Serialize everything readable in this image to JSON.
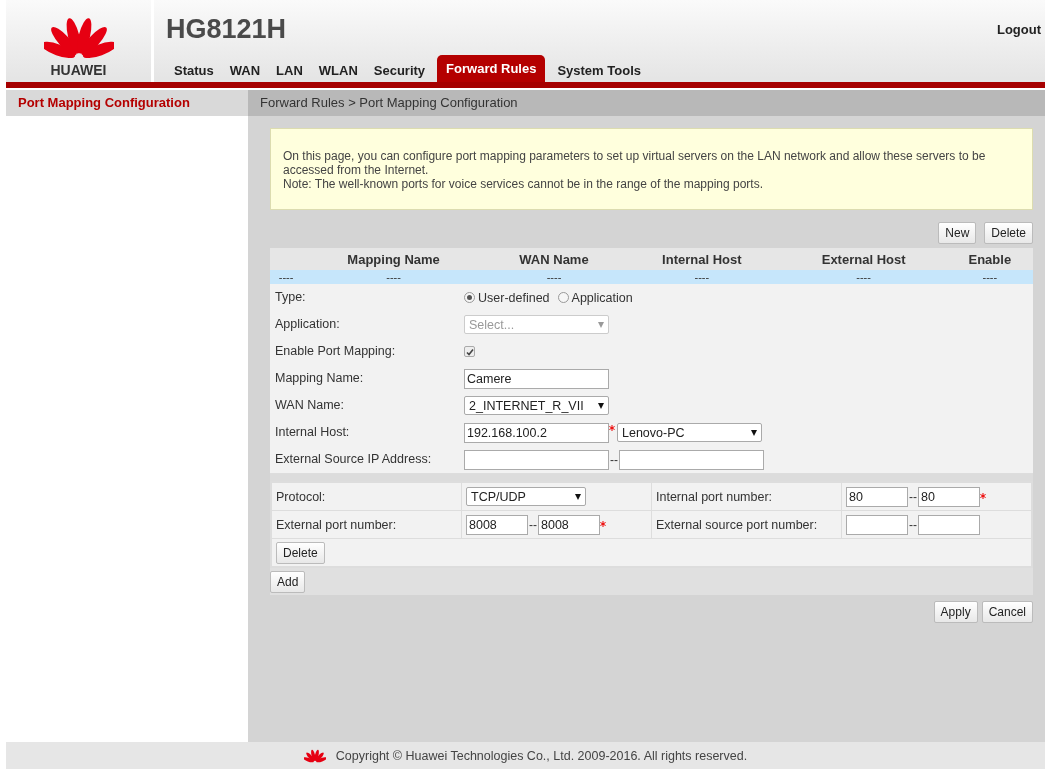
{
  "header": {
    "brand": "HUAWEI",
    "model": "HG8121H",
    "logout": "Logout",
    "tabs": [
      {
        "label": "Status",
        "selected": false
      },
      {
        "label": "WAN",
        "selected": false
      },
      {
        "label": "LAN",
        "selected": false
      },
      {
        "label": "WLAN",
        "selected": false
      },
      {
        "label": "Security",
        "selected": false
      },
      {
        "label": "Forward Rules",
        "selected": true
      },
      {
        "label": "System Tools",
        "selected": false
      }
    ]
  },
  "sidebar": {
    "items": [
      {
        "label": "Port Mapping Configuration",
        "selected": true
      }
    ]
  },
  "breadcrumb": "Forward Rules > Port Mapping Configuration",
  "notice": [
    "On this page, you can configure port mapping parameters to set up virtual servers on the LAN network and allow these servers to be accessed from the Internet.",
    "Note: The well-known ports for voice services cannot be in the range of the mapping ports."
  ],
  "toolbar": [
    "New",
    "Delete"
  ],
  "table": {
    "columns": [
      "",
      "Mapping Name",
      "WAN Name",
      "Internal Host",
      "External Host",
      "Enable"
    ],
    "rows": [
      [
        "----",
        "----",
        "----",
        "----",
        "----",
        "----"
      ]
    ]
  },
  "form": [
    {
      "kind": "radio",
      "label": "Type:",
      "options": [
        {
          "label": "User-defined",
          "selected": true
        },
        {
          "label": "Application",
          "selected": false
        }
      ]
    },
    {
      "kind": "select",
      "label": "Application:",
      "placeholder": "Select...",
      "disabled": true
    },
    {
      "kind": "checkbox",
      "label": "Enable Port Mapping:",
      "checked": true,
      "disabled": true
    },
    {
      "kind": "text",
      "label": "Mapping Name:",
      "value": "Camere"
    },
    {
      "kind": "select",
      "label": "WAN Name:",
      "value": "2_INTERNET_R_VII",
      "disabled": false
    },
    {
      "kind": "host",
      "label": "Internal Host:",
      "value": "192.168.100.2",
      "required": true,
      "host": "Lenovo-PC"
    },
    {
      "kind": "range",
      "label": "External Source IP Address:",
      "separator": "--"
    }
  ],
  "port_rules": [
    {
      "protocol_label": "Protocol:",
      "protocol": "TCP/UDP",
      "internal_label": "Internal port number:",
      "internal_from": "80",
      "internal_separator": "--",
      "internal_to": "80",
      "internal_required": true,
      "external_label": "External port number:",
      "external_from": "8008",
      "external_separator": "--",
      "external_to": "8008",
      "external_required": true,
      "source_label": "External source port number:",
      "source_separator": "--",
      "delete": "Delete"
    }
  ],
  "add": "Add",
  "actions": [
    "Apply",
    "Cancel"
  ],
  "footer": "Copyright © Huawei Technologies Co., Ltd. 2009-2016. All rights reserved."
}
